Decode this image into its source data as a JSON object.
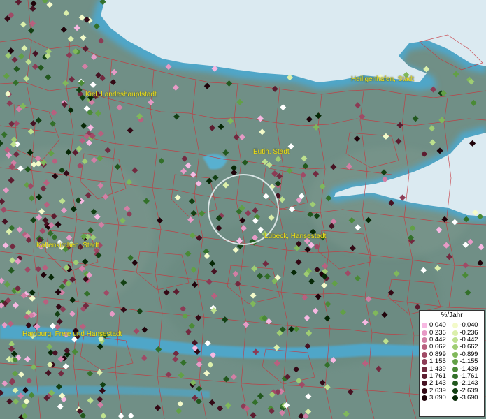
{
  "cities": [
    {
      "id": "kiel",
      "label": "Kiel, Landeshauptstadt"
    },
    {
      "id": "heiligenhafen",
      "label": "Heiligenhafen, Stadt"
    },
    {
      "id": "eutin",
      "label": "Eutin, Stadt"
    },
    {
      "id": "luebeck",
      "label": "Lübeck, Hansestadt"
    },
    {
      "id": "kaltenkirchen",
      "label": "Kaltenkirchen, Stadt"
    },
    {
      "id": "hamburg",
      "label": "Hamburg, Freie und Hansestadt"
    }
  ],
  "legend": {
    "title": "%/Jahr",
    "positive": [
      {
        "label": "0.040",
        "color": "#f7b8e2"
      },
      {
        "label": "0.236",
        "color": "#e79ac6"
      },
      {
        "label": "0.442",
        "color": "#d27fa5"
      },
      {
        "label": "0.662",
        "color": "#b8607f"
      },
      {
        "label": "0.899",
        "color": "#a04a66"
      },
      {
        "label": "1.155",
        "color": "#8c3b55"
      },
      {
        "label": "1.439",
        "color": "#722a40"
      },
      {
        "label": "1.761",
        "color": "#5c1c2f"
      },
      {
        "label": "2.143",
        "color": "#461222"
      },
      {
        "label": "2.639",
        "color": "#330915"
      },
      {
        "label": "3.690",
        "color": "#1f030a"
      }
    ],
    "negative": [
      {
        "label": "-0.040",
        "color": "#f3fac9"
      },
      {
        "label": "-0.236",
        "color": "#dbefab"
      },
      {
        "label": "-0.442",
        "color": "#bde08e"
      },
      {
        "label": "-0.662",
        "color": "#9fcd73"
      },
      {
        "label": "-0.899",
        "color": "#80b85b"
      },
      {
        "label": "-1.155",
        "color": "#62a046"
      },
      {
        "label": "-1.439",
        "color": "#4a8a36"
      },
      {
        "label": "-1.761",
        "color": "#33702a"
      },
      {
        "label": "-2.143",
        "color": "#22581e"
      },
      {
        "label": "-2.639",
        "color": "#134013"
      },
      {
        "label": "-3.690",
        "color": "#062806"
      }
    ]
  },
  "colors": {
    "land": "#6f8f86",
    "sea": "#dbeaf1",
    "water": "#4ea6c9",
    "boundaries": "#c8353c",
    "label": "#f2e21a"
  }
}
